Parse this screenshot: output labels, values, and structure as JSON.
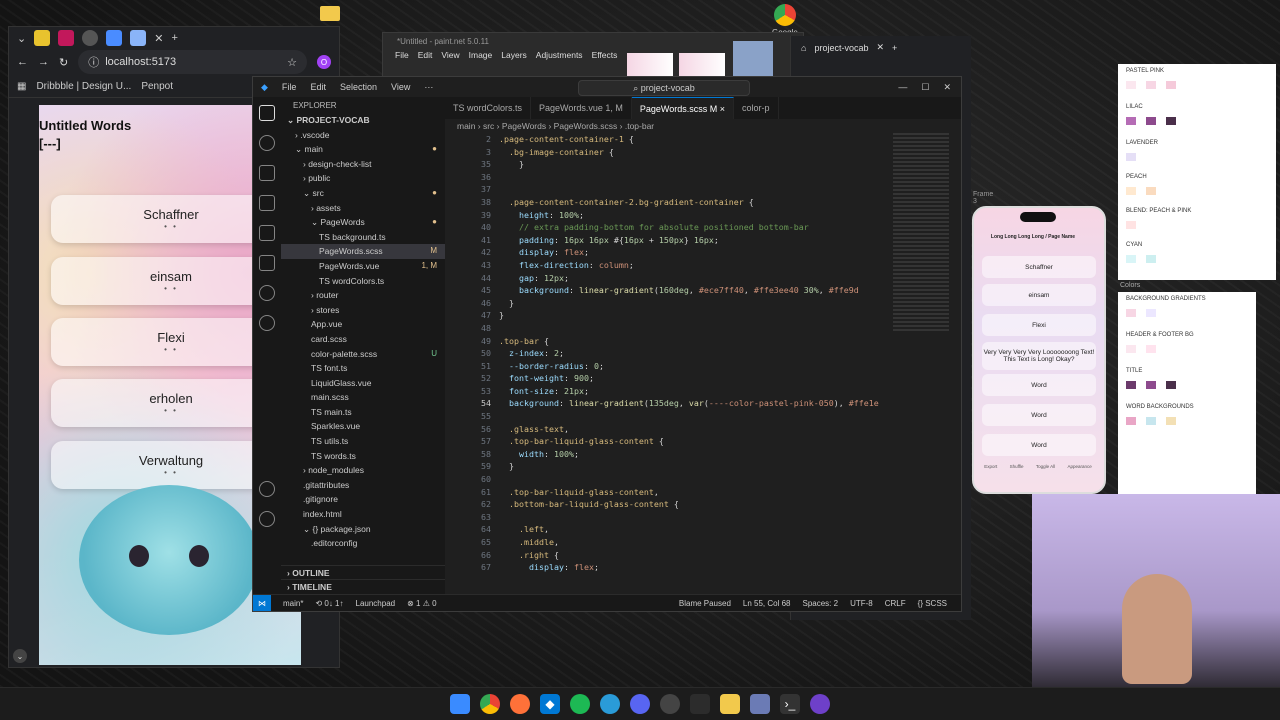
{
  "desktop": {
    "google_label": "Google"
  },
  "browser": {
    "url": "localhost:5173",
    "profile_initial": "O",
    "bookmarks": [
      "Dribbble | Design U...",
      "Penpot"
    ],
    "page": {
      "title_line1": "Untitled Words",
      "title_line2": "[---]",
      "words": [
        "Schaffner",
        "einsam",
        "Flexi",
        "erholen",
        "Verwaltung"
      ],
      "dots": "• •"
    }
  },
  "paintnet": {
    "title": "*Untitled - paint.net 5.0.11",
    "menu": [
      "File",
      "Edit",
      "View",
      "Image",
      "Layers",
      "Adjustments",
      "Effects"
    ]
  },
  "vscode": {
    "menu": [
      "File",
      "Edit",
      "Selection",
      "View",
      "···"
    ],
    "search": "project-vocab",
    "explorer_header": "EXPLORER",
    "project": "PROJECT-VOCAB",
    "tree": [
      {
        "label": "› .vscode",
        "indent": 1
      },
      {
        "label": "⌄ main",
        "indent": 1,
        "badge": "●"
      },
      {
        "label": "› design-check-list",
        "indent": 2
      },
      {
        "label": "› public",
        "indent": 2
      },
      {
        "label": "⌄ src",
        "indent": 2,
        "badge": "●"
      },
      {
        "label": "› assets",
        "indent": 3
      },
      {
        "label": "⌄ PageWords",
        "indent": 3,
        "badge": "●"
      },
      {
        "label": "TS background.ts",
        "indent": 4
      },
      {
        "label": "PageWords.scss",
        "indent": 4,
        "badge": "M",
        "selected": true
      },
      {
        "label": "PageWords.vue",
        "indent": 4,
        "badge": "1, M"
      },
      {
        "label": "TS wordColors.ts",
        "indent": 4
      },
      {
        "label": "› router",
        "indent": 3
      },
      {
        "label": "› stores",
        "indent": 3
      },
      {
        "label": "App.vue",
        "indent": 3
      },
      {
        "label": "card.scss",
        "indent": 3
      },
      {
        "label": "color-palette.scss",
        "indent": 3,
        "badge": "U"
      },
      {
        "label": "TS font.ts",
        "indent": 3
      },
      {
        "label": "LiquidGlass.vue",
        "indent": 3
      },
      {
        "label": "main.scss",
        "indent": 3
      },
      {
        "label": "TS main.ts",
        "indent": 3
      },
      {
        "label": "Sparkles.vue",
        "indent": 3
      },
      {
        "label": "TS utils.ts",
        "indent": 3
      },
      {
        "label": "TS words.ts",
        "indent": 3
      },
      {
        "label": "› node_modules",
        "indent": 2
      },
      {
        "label": ".gitattributes",
        "indent": 2
      },
      {
        "label": ".gitignore",
        "indent": 2
      },
      {
        "label": "index.html",
        "indent": 2
      },
      {
        "label": "⌄ {} package.json",
        "indent": 2
      },
      {
        "label": ".editorconfig",
        "indent": 3
      }
    ],
    "outline": "OUTLINE",
    "timeline": "TIMELINE",
    "tabs": [
      {
        "label": "TS wordColors.ts",
        "active": false
      },
      {
        "label": "PageWords.vue 1, M",
        "active": false
      },
      {
        "label": "PageWords.scss M ×",
        "active": true
      },
      {
        "label": "color-p",
        "active": false
      }
    ],
    "breadcrumb": "main › src › PageWords › PageWords.scss › .top-bar",
    "code_lines": [
      {
        "n": "2",
        "html": "<span class='sel'>.page-content-container-1</span> {"
      },
      {
        "n": "3",
        "html": "  <span class='sel'>.bg-image-container</span> {"
      },
      {
        "n": "35",
        "html": "    }"
      },
      {
        "n": "36",
        "html": ""
      },
      {
        "n": "37",
        "html": ""
      },
      {
        "n": "38",
        "html": "  <span class='sel'>.page-content-container-2.bg-gradient-container</span> {"
      },
      {
        "n": "39",
        "html": "    <span class='prop'>height</span>: <span class='num'>100%</span>;"
      },
      {
        "n": "40",
        "html": "    <span class='cm'>// extra padding-bottom for absolute positioned bottom-bar</span>"
      },
      {
        "n": "41",
        "html": "    <span class='prop'>padding</span>: <span class='num'>16px 16px</span> #{<span class='num'>16px</span> + <span class='num'>150px</span>} <span class='num'>16px</span>;"
      },
      {
        "n": "42",
        "html": "    <span class='prop'>display</span>: <span class='val'>flex</span>;"
      },
      {
        "n": "43",
        "html": "    <span class='prop'>flex-direction</span>: <span class='val'>column</span>;"
      },
      {
        "n": "44",
        "html": "    <span class='prop'>gap</span>: <span class='num'>12px</span>;"
      },
      {
        "n": "45",
        "html": "    <span class='prop'>background</span>: <span class='fn'>linear-gradient</span>(<span class='num'>160deg</span>, <span class='val'>#ece7ff40</span>, <span class='val'>#ffe3ee40</span> <span class='num'>30%</span>, <span class='val'>#ffe9d</span>"
      },
      {
        "n": "46",
        "html": "  }"
      },
      {
        "n": "47",
        "html": "}"
      },
      {
        "n": "48",
        "html": ""
      },
      {
        "n": "49",
        "html": "<span class='sel'>.top-bar</span> {"
      },
      {
        "n": "50",
        "html": "  <span class='prop'>z-index</span>: <span class='num'>2</span>;"
      },
      {
        "n": "51",
        "html": "  <span class='prop'>--border-radius</span>: <span class='num'>0</span>;"
      },
      {
        "n": "52",
        "html": "  <span class='prop'>font-weight</span>: <span class='num'>900</span>;"
      },
      {
        "n": "53",
        "html": "  <span class='prop'>font-size</span>: <span class='num'>21px</span>;"
      },
      {
        "n": "54",
        "html": "  <span class='prop'>background</span>: <span class='fn'>linear-gradient</span>(<span class='num'>135deg</span>, <span class='fn'>var</span>(<span class='val'>----color-pastel-pink-050</span>), <span class='val'>#ffe1e</span>",
        "current": true
      },
      {
        "n": "55",
        "html": ""
      },
      {
        "n": "56",
        "html": "  <span class='sel'>.glass-text</span>,"
      },
      {
        "n": "57",
        "html": "  <span class='sel'>.top-bar-liquid-glass-content</span> {"
      },
      {
        "n": "58",
        "html": "    <span class='prop'>width</span>: <span class='num'>100%</span>;"
      },
      {
        "n": "59",
        "html": "  }"
      },
      {
        "n": "60",
        "html": ""
      },
      {
        "n": "61",
        "html": "  <span class='sel'>.top-bar-liquid-glass-content</span>,"
      },
      {
        "n": "62",
        "html": "  <span class='sel'>.bottom-bar-liquid-glass-content</span> {"
      },
      {
        "n": "63",
        "html": ""
      },
      {
        "n": "64",
        "html": "    <span class='sel'>.left</span>,"
      },
      {
        "n": "65",
        "html": "    <span class='sel'>.middle</span>,"
      },
      {
        "n": "66",
        "html": "    <span class='sel'>.right</span> {"
      },
      {
        "n": "67",
        "html": "      <span class='prop'>display</span>: <span class='val'>flex</span>;"
      }
    ],
    "status": {
      "branch": "main*",
      "sync": "⟲ 0↓ 1↑",
      "launchpad": "Launchpad",
      "problems": "⊗ 1 ⚠ 0",
      "blame": "Blame Paused",
      "position": "Ln 55, Col 68",
      "spaces": "Spaces: 2",
      "encoding": "UTF-8",
      "eol": "CRLF",
      "language": "{} SCSS"
    }
  },
  "browser2": {
    "tab_title": "project-vocab",
    "frame_label": "Frame 3"
  },
  "phone": {
    "header": "Long Long Long Long / Page Name",
    "cards": [
      "Schaffner",
      "einsam",
      "Flexi",
      "Very Very Very Very Looooooong Text! This Text is Long! Okay?",
      "Word",
      "Word",
      "Word"
    ],
    "nav": [
      "Export",
      "Shuffle",
      "Toggle All",
      "Appearance"
    ]
  },
  "palette": {
    "sections": [
      "PASTEL PINK",
      "LILAC",
      "LAVENDER",
      "PEACH",
      "BLEND: PEACH & PINK",
      "CYAN"
    ],
    "colors_label": "Colors",
    "sections2": [
      "BACKGROUND GRADIENTS",
      "HEADER & FOOTER BG",
      "TITLE",
      "WORD BACKGROUNDS"
    ]
  }
}
